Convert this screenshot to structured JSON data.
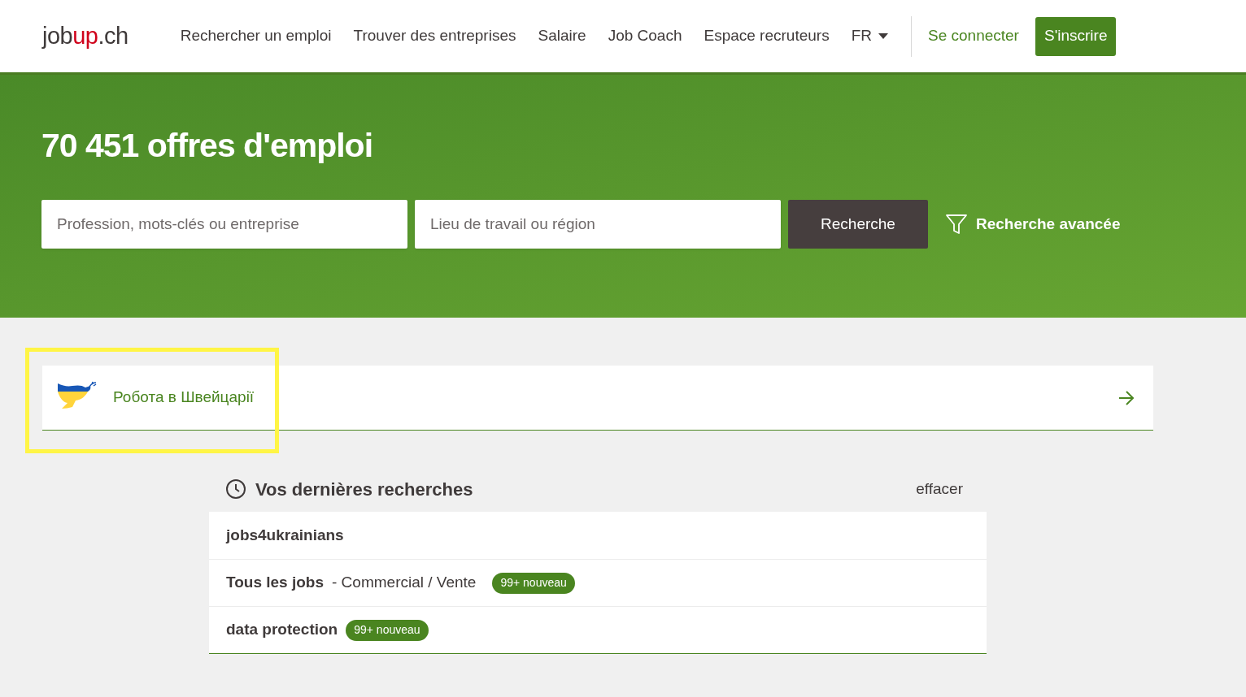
{
  "header": {
    "logo": [
      {
        "text": "job",
        "accent": false
      },
      {
        "text": "up",
        "accent": true
      },
      {
        "text": ".ch",
        "accent": false
      }
    ],
    "nav": [
      "Rechercher un emploi",
      "Trouver des entreprises",
      "Salaire",
      "Job Coach",
      "Espace recruteurs"
    ],
    "language": "FR",
    "login": "Se connecter",
    "signup": "S'inscrire"
  },
  "hero": {
    "title": "70 451 offres d'emploi",
    "keyword_placeholder": "Profession, mots-clés ou entreprise",
    "location_placeholder": "Lieu de travail ou région",
    "search": "Recherche",
    "advanced": "Recherche avancée"
  },
  "banner": {
    "label": "Робота в Швейцарії",
    "highlighted": true
  },
  "recent": {
    "title": "Vos dernières recherches",
    "clear": "effacer",
    "items": [
      {
        "query": "jobs4ukrainians"
      },
      {
        "query": "Tous les jobs",
        "detail": "- Commercial / Vente",
        "badge": "99+ nouveau"
      },
      {
        "query": "data protection",
        "badge": "99+ nouveau"
      }
    ]
  }
}
